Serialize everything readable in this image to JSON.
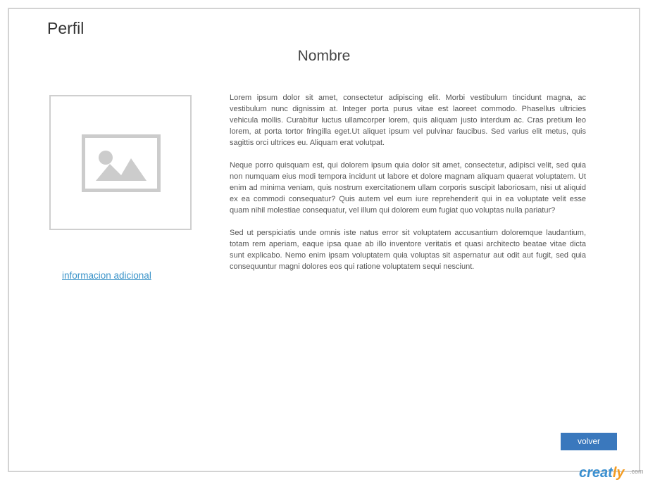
{
  "page": {
    "title": "Perfil",
    "name": "Nombre"
  },
  "profile_image": {
    "icon": "image-placeholder-icon",
    "border_color": "#cfcfcf",
    "icon_color": "#cccccc"
  },
  "links": {
    "more_info": "informacion adicional"
  },
  "content": {
    "paragraphs": [
      "Lorem ipsum dolor sit amet, consectetur adipiscing elit. Morbi vestibulum tincidunt magna, ac vestibulum nunc dignissim at. Integer porta purus vitae est laoreet commodo. Phasellus ultricies vehicula mollis. Curabitur luctus ullamcorper lorem, quis aliquam justo interdum ac. Cras pretium leo lorem, at porta tortor fringilla eget.Ut aliquet ipsum vel pulvinar faucibus. Sed varius elit metus, quis sagittis orci ultrices eu. Aliquam erat volutpat.",
      "Neque porro quisquam est, qui dolorem ipsum quia dolor sit amet, consectetur, adipisci velit, sed quia non numquam eius modi tempora incidunt ut labore et dolore magnam aliquam quaerat voluptatem. Ut enim ad minima veniam, quis nostrum exercitationem ullam corporis suscipit laboriosam, nisi ut aliquid ex ea commodi consequatur? Quis autem vel eum iure reprehenderit qui in ea voluptate velit esse quam nihil molestiae consequatur, vel illum qui dolorem eum fugiat quo voluptas nulla pariatur?",
      "Sed ut perspiciatis unde omnis iste natus error sit voluptatem accusantium doloremque laudantium, totam rem aperiam, eaque ipsa quae ab illo inventore veritatis et quasi architecto beatae vitae dicta sunt explicabo. Nemo enim ipsam voluptatem quia voluptas sit aspernatur aut odit aut fugit, sed quia consequuntur magni dolores eos qui ratione voluptatem sequi nesciunt."
    ]
  },
  "actions": {
    "back_label": "volver"
  },
  "watermark": {
    "brand_main": "creat",
    "brand_accent": "ly",
    "domain": ".com"
  },
  "colors": {
    "link": "#3a93c9",
    "button": "#3a78bd",
    "frame_border": "#d3d3d3",
    "text": "#555555"
  }
}
